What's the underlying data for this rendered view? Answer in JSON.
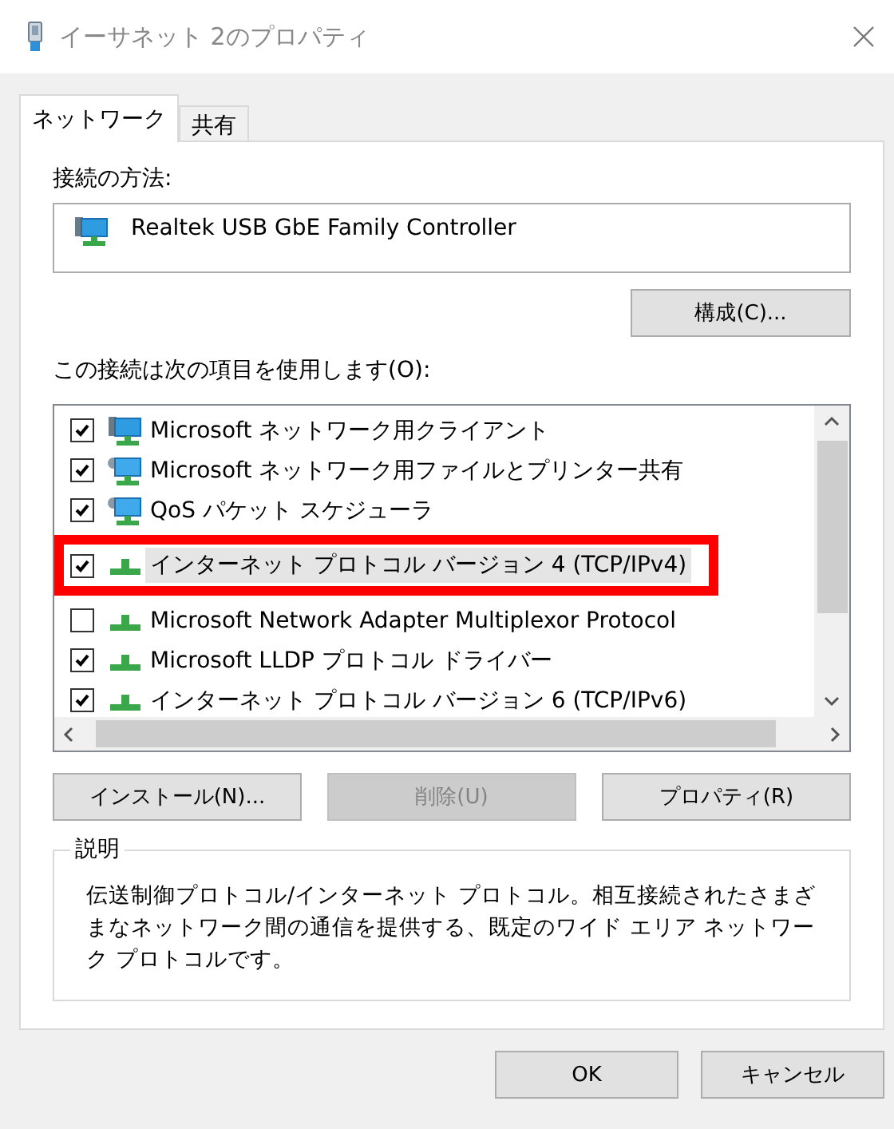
{
  "window": {
    "title": "イーサネット 2のプロパティ"
  },
  "tabs": [
    {
      "label": "ネットワーク",
      "selected": true
    },
    {
      "label": "共有",
      "selected": false
    }
  ],
  "connection": {
    "label": "接続の方法:",
    "adapter": "Realtek USB GbE Family Controller"
  },
  "configure_button": "構成(C)...",
  "items_label": "この接続は次の項目を使用します(O):",
  "items": [
    {
      "kind": "client",
      "label": "Microsoft ネットワーク用クライアント",
      "checked": true,
      "selected": false,
      "highlighted": false
    },
    {
      "kind": "service",
      "label": "Microsoft ネットワーク用ファイルとプリンター共有",
      "checked": true,
      "selected": false,
      "highlighted": false
    },
    {
      "kind": "service",
      "label": "QoS パケット スケジューラ",
      "checked": true,
      "selected": false,
      "highlighted": false
    },
    {
      "kind": "protocol",
      "label": "インターネット プロトコル バージョン 4 (TCP/IPv4)",
      "checked": true,
      "selected": true,
      "highlighted": true
    },
    {
      "kind": "protocol",
      "label": "Microsoft Network Adapter Multiplexor Protocol",
      "checked": false,
      "selected": false,
      "highlighted": false
    },
    {
      "kind": "protocol",
      "label": "Microsoft LLDP プロトコル ドライバー",
      "checked": true,
      "selected": false,
      "highlighted": false
    },
    {
      "kind": "protocol",
      "label": "インターネット プロトコル バージョン 6 (TCP/IPv6)",
      "checked": true,
      "selected": false,
      "highlighted": false
    }
  ],
  "item_buttons": [
    {
      "label": "インストール(N)...",
      "disabled": false
    },
    {
      "label": "削除(U)",
      "disabled": true
    },
    {
      "label": "プロパティ(R)",
      "disabled": false
    }
  ],
  "description": {
    "legend": "説明",
    "text": "伝送制御プロトコル/インターネット プロトコル。相互接続されたさまざまなネットワーク間の通信を提供する、既定のワイド エリア ネットワーク プロトコルです。"
  },
  "dialog_buttons": [
    {
      "label": "OK"
    },
    {
      "label": "キャンセル"
    }
  ]
}
